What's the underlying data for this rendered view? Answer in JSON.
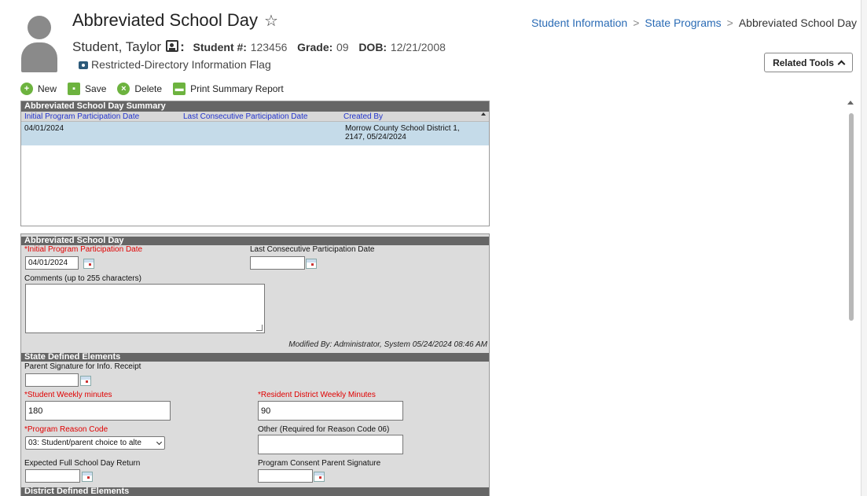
{
  "header": {
    "title": "Abbreviated School Day",
    "student_name": "Student, Taylor",
    "student_num_label": "Student #:",
    "student_num": "123456",
    "grade_label": "Grade:",
    "grade": "09",
    "dob_label": "DOB:",
    "dob": "12/21/2008",
    "flag": "Restricted-Directory Information Flag"
  },
  "breadcrumb": {
    "items": [
      "Student Information",
      "State Programs"
    ],
    "current": "Abbreviated School Day"
  },
  "related_tools_label": "Related Tools",
  "toolbar": {
    "new": "New",
    "save": "Save",
    "delete": "Delete",
    "print": "Print Summary Report"
  },
  "summary": {
    "title": "Abbreviated School Day Summary",
    "columns": [
      "Initial Program Participation Date",
      "Last Consecutive Participation Date",
      "Created By"
    ],
    "rows": [
      {
        "initial_date": "04/01/2024",
        "last_date": "",
        "created_by_line1": "Morrow County School District 1,",
        "created_by_line2": "2147, 05/24/2024"
      }
    ]
  },
  "detail": {
    "title": "Abbreviated School Day",
    "initial_date_label": "*Initial Program Participation Date",
    "initial_date_value": "04/01/2024",
    "last_date_label": "Last Consecutive Participation Date",
    "last_date_value": "",
    "comments_label": "Comments (up to 255 characters)",
    "comments_value": "",
    "modified_by": "Modified By: Administrator, System 05/24/2024 08:46 AM"
  },
  "state_elements": {
    "title": "State Defined Elements",
    "parent_sig_label": "Parent Signature for Info. Receipt",
    "parent_sig_value": "",
    "student_minutes_label": "*Student Weekly minutes",
    "student_minutes_value": "180",
    "resident_minutes_label": "*Resident District Weekly Minutes",
    "resident_minutes_value": "90",
    "reason_code_label": "*Program Reason Code",
    "reason_code_value": "03: Student/parent choice to alte",
    "other_label": "Other (Required for Reason Code 06)",
    "other_value": "",
    "expected_return_label": "Expected Full School Day Return",
    "expected_return_value": "",
    "consent_label": "Program Consent Parent Signature",
    "consent_value": ""
  },
  "district_elements": {
    "title": "District Defined Elements"
  }
}
